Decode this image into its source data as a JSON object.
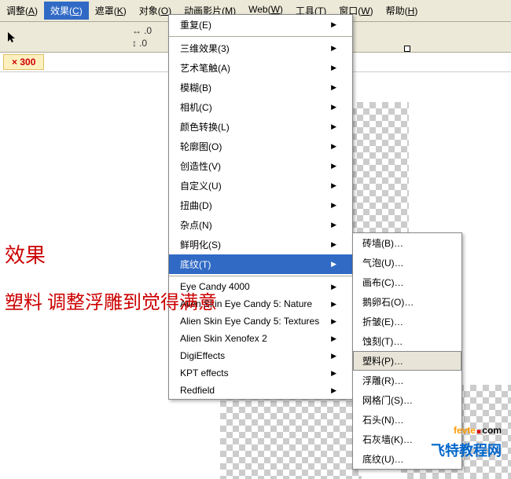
{
  "menubar": [
    {
      "label": "调整",
      "key": "A"
    },
    {
      "label": "效果",
      "key": "C"
    },
    {
      "label": "遮罩",
      "key": "K"
    },
    {
      "label": "对象",
      "key": "O"
    },
    {
      "label": "动画影片",
      "key": "M"
    },
    {
      "label": "Web",
      "key": "W"
    },
    {
      "label": "工具",
      "key": "T"
    },
    {
      "label": "窗口",
      "key": "W"
    },
    {
      "label": "帮助",
      "key": "H"
    }
  ],
  "toolbar": {
    "val1": ".0",
    "val2": ".0"
  },
  "coord": {
    "sep": "×",
    "value": "300"
  },
  "effects_menu": {
    "items1": [
      {
        "label": "重复",
        "key": "E",
        "arrow": true
      }
    ],
    "items2": [
      {
        "label": "三维效果",
        "key": "3",
        "arrow": true
      },
      {
        "label": "艺术笔触",
        "key": "A",
        "arrow": true
      },
      {
        "label": "模糊",
        "key": "B",
        "arrow": true
      },
      {
        "label": "相机",
        "key": "C",
        "arrow": true
      },
      {
        "label": "颜色转换",
        "key": "L",
        "arrow": true
      },
      {
        "label": "轮廓图",
        "key": "O",
        "arrow": true
      },
      {
        "label": "创造性",
        "key": "V",
        "arrow": true
      },
      {
        "label": "自定义",
        "key": "U",
        "arrow": true
      },
      {
        "label": "扭曲",
        "key": "D",
        "arrow": true
      },
      {
        "label": "杂点",
        "key": "N",
        "arrow": true
      },
      {
        "label": "鲜明化",
        "key": "S",
        "arrow": true
      },
      {
        "label": "底纹",
        "key": "T",
        "arrow": true,
        "hl": true
      }
    ],
    "items3": [
      {
        "label": "Eye Candy 4000",
        "arrow": true
      },
      {
        "label": "Alien Skin Eye Candy 5: Nature",
        "arrow": true
      },
      {
        "label": "Alien Skin Eye Candy 5: Textures",
        "arrow": true
      },
      {
        "label": "Alien Skin Xenofex 2",
        "arrow": true
      },
      {
        "label": "DigiEffects",
        "arrow": true
      },
      {
        "label": "KPT effects",
        "arrow": true
      },
      {
        "label": "Redfield",
        "arrow": true
      }
    ]
  },
  "texture_submenu": [
    {
      "label": "砖墙(B)…"
    },
    {
      "label": "气泡(U)…"
    },
    {
      "label": "画布(C)…"
    },
    {
      "label": "鹅卵石(O)…"
    },
    {
      "label": "折皱(E)…"
    },
    {
      "label": "蚀刻(T)…"
    },
    {
      "label": "塑料(P)…",
      "hl": true
    },
    {
      "label": "浮雕(R)…"
    },
    {
      "label": "网格门(S)…"
    },
    {
      "label": "石头(N)…"
    },
    {
      "label": "石灰墙(K)…"
    },
    {
      "label": "底纹(U)…"
    }
  ],
  "overlay": {
    "line1": "效果",
    "line2": "塑料 调整浮雕到觉得满意"
  },
  "watermark": {
    "brand_f": "fevte",
    "brand_dot": ".",
    "brand_com": "com",
    "subtitle": "飞特教程网"
  }
}
